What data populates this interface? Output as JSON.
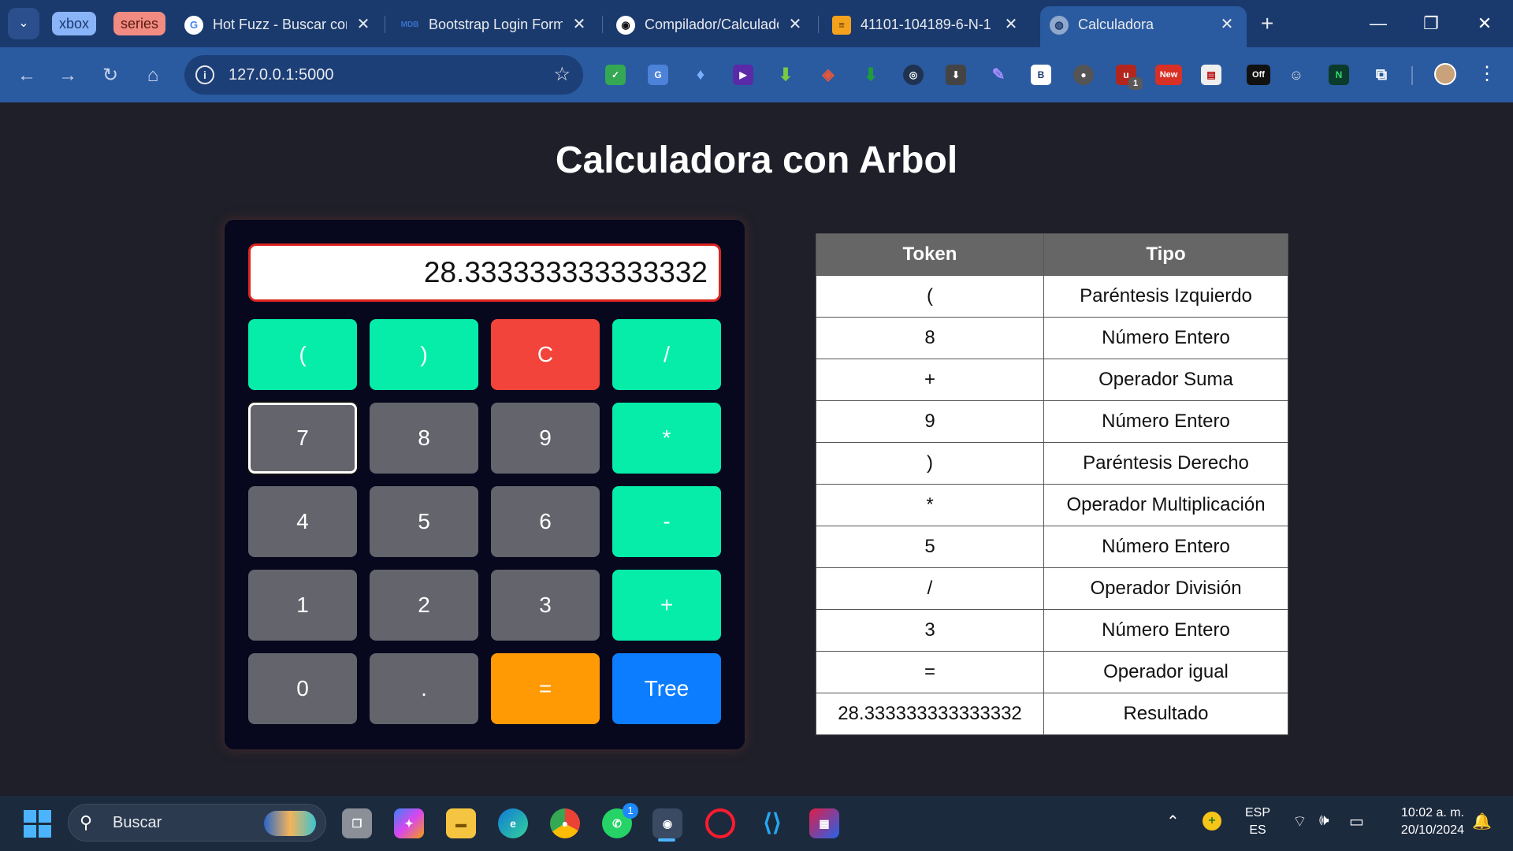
{
  "browser": {
    "tab_groups": [
      "xbox",
      "series"
    ],
    "tabs": [
      {
        "label": "Hot Fuzz - Buscar con Google",
        "favicon": "google-icon",
        "fav_text": "G"
      },
      {
        "label": "Bootstrap Login Form",
        "favicon": "mdb-icon",
        "fav_text": "MDB"
      },
      {
        "label": "Compilador/Calculadora",
        "favicon": "github-icon",
        "fav_text": "◉"
      },
      {
        "label": "41101-104189-6-N-1",
        "favicon": "document-icon",
        "fav_text": "≡"
      },
      {
        "label": "Calculadora",
        "favicon": "globe-icon",
        "fav_text": "◍",
        "active": true
      }
    ],
    "url": "127.0.0.1:5000",
    "extension_badges": {
      "counter": "1",
      "new": "New",
      "off": "Off",
      "b": "B",
      "n": "N"
    }
  },
  "page": {
    "title": "Calculadora con Arbol",
    "display": "28.333333333333332",
    "keys": [
      {
        "label": "(",
        "style": "teal"
      },
      {
        "label": ")",
        "style": "teal"
      },
      {
        "label": "C",
        "style": "red"
      },
      {
        "label": "/",
        "style": "teal"
      },
      {
        "label": "7",
        "style": "gray",
        "focused": true
      },
      {
        "label": "8",
        "style": "gray"
      },
      {
        "label": "9",
        "style": "gray"
      },
      {
        "label": "*",
        "style": "teal"
      },
      {
        "label": "4",
        "style": "gray"
      },
      {
        "label": "5",
        "style": "gray"
      },
      {
        "label": "6",
        "style": "gray"
      },
      {
        "label": "-",
        "style": "teal"
      },
      {
        "label": "1",
        "style": "gray"
      },
      {
        "label": "2",
        "style": "gray"
      },
      {
        "label": "3",
        "style": "gray"
      },
      {
        "label": "+",
        "style": "teal"
      },
      {
        "label": "0",
        "style": "gray"
      },
      {
        "label": ".",
        "style": "gray"
      },
      {
        "label": "=",
        "style": "orange"
      },
      {
        "label": "Tree",
        "style": "blue"
      }
    ],
    "table": {
      "headers": [
        "Token",
        "Tipo"
      ],
      "rows": [
        [
          "(",
          "Paréntesis Izquierdo"
        ],
        [
          "8",
          "Número Entero"
        ],
        [
          "+",
          "Operador Suma"
        ],
        [
          "9",
          "Número Entero"
        ],
        [
          ")",
          "Paréntesis Derecho"
        ],
        [
          "*",
          "Operador Multiplicación"
        ],
        [
          "5",
          "Número Entero"
        ],
        [
          "/",
          "Operador División"
        ],
        [
          "3",
          "Número Entero"
        ],
        [
          "=",
          "Operador igual"
        ],
        [
          "28.333333333333332",
          "Resultado"
        ]
      ]
    }
  },
  "taskbar": {
    "search_placeholder": "Buscar",
    "whatsapp_badge": "1",
    "language_top": "ESP",
    "language_bottom": "ES",
    "time": "10:02 a. m.",
    "date": "20/10/2024"
  },
  "colors": {
    "teal": "#05eda9",
    "red": "#f2443a",
    "gray": "#64646c",
    "orange": "#ff9a04",
    "blue": "#0d7dff",
    "display_border": "#dc2420"
  }
}
